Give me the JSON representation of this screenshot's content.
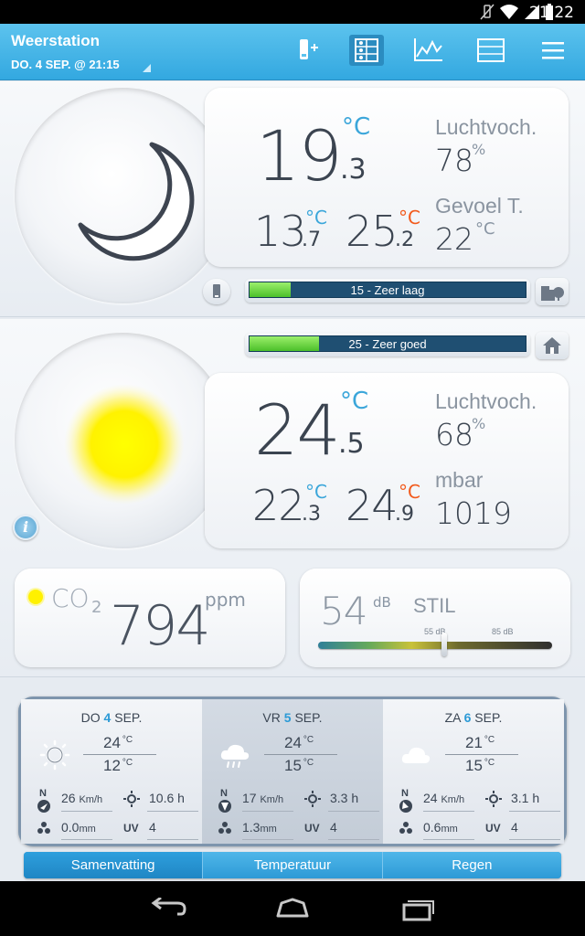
{
  "status_bar": {
    "time": "21:22"
  },
  "header": {
    "title": "Weerstation",
    "date": "DO. 4 SEP. @ 21:15"
  },
  "outdoor": {
    "temp_int": "19",
    "temp_dec": ".3",
    "temp_unit": "°C",
    "min_int": "13",
    "min_dec": ".7",
    "max_int": "25",
    "max_dec": ".2",
    "humidity_label": "Luchtvoch.",
    "humidity_value": "78",
    "humidity_unit": "%",
    "feel_label": "Gevoel T.",
    "feel_value": "22",
    "feel_unit": "°C",
    "air_quality_text": "15 - Zeer laag",
    "air_quality_fraction": 0.15
  },
  "indoor": {
    "comfort_text": "25 - Zeer goed",
    "comfort_fraction": 0.25,
    "temp_int": "24",
    "temp_dec": ".5",
    "temp_unit": "°C",
    "min_int": "22",
    "min_dec": ".3",
    "max_int": "24",
    "max_dec": ".9",
    "humidity_label": "Luchtvoch.",
    "humidity_value": "68",
    "humidity_unit": "%",
    "pressure_label": "mbar",
    "pressure_value": "1019"
  },
  "co2": {
    "label": "CO",
    "sub": "2",
    "value": "794",
    "unit": "ppm"
  },
  "noise": {
    "value": "54",
    "unit": "dB",
    "label": "STIL",
    "mark1": "55 dB",
    "mark2": "85 dB",
    "level_fraction": 0.54
  },
  "forecast": [
    {
      "dow": "DO",
      "day": "4",
      "month": "SEP.",
      "hi": "24",
      "lo": "12",
      "unit": "°C",
      "wind": "26",
      "wind_unit": "Km/h",
      "sun": "10.6 h",
      "rain": "0.0",
      "rain_unit": "mm",
      "uv_label": "UV",
      "uv": "4",
      "wind_dir_label": "N",
      "icon": "sun-icon"
    },
    {
      "dow": "VR",
      "day": "5",
      "month": "SEP.",
      "hi": "24",
      "lo": "15",
      "unit": "°C",
      "wind": "17",
      "wind_unit": "Km/h",
      "sun": "3.3 h",
      "rain": "1.3",
      "rain_unit": "mm",
      "uv_label": "UV",
      "uv": "4",
      "wind_dir_label": "N",
      "icon": "rain-cloud-icon"
    },
    {
      "dow": "ZA",
      "day": "6",
      "month": "SEP.",
      "hi": "21",
      "lo": "15",
      "unit": "°C",
      "wind": "24",
      "wind_unit": "Km/h",
      "sun": "3.1 h",
      "rain": "0.6",
      "rain_unit": "mm",
      "uv_label": "UV",
      "uv": "4",
      "wind_dir_label": "N",
      "icon": "cloud-icon"
    }
  ],
  "tabs": [
    "Samenvatting",
    "Temperatuur",
    "Regen"
  ],
  "colors": {
    "accent": "#33a8e0",
    "cold": "#3ba6da",
    "warm": "#f25a1c",
    "sun": "#ffee00"
  }
}
